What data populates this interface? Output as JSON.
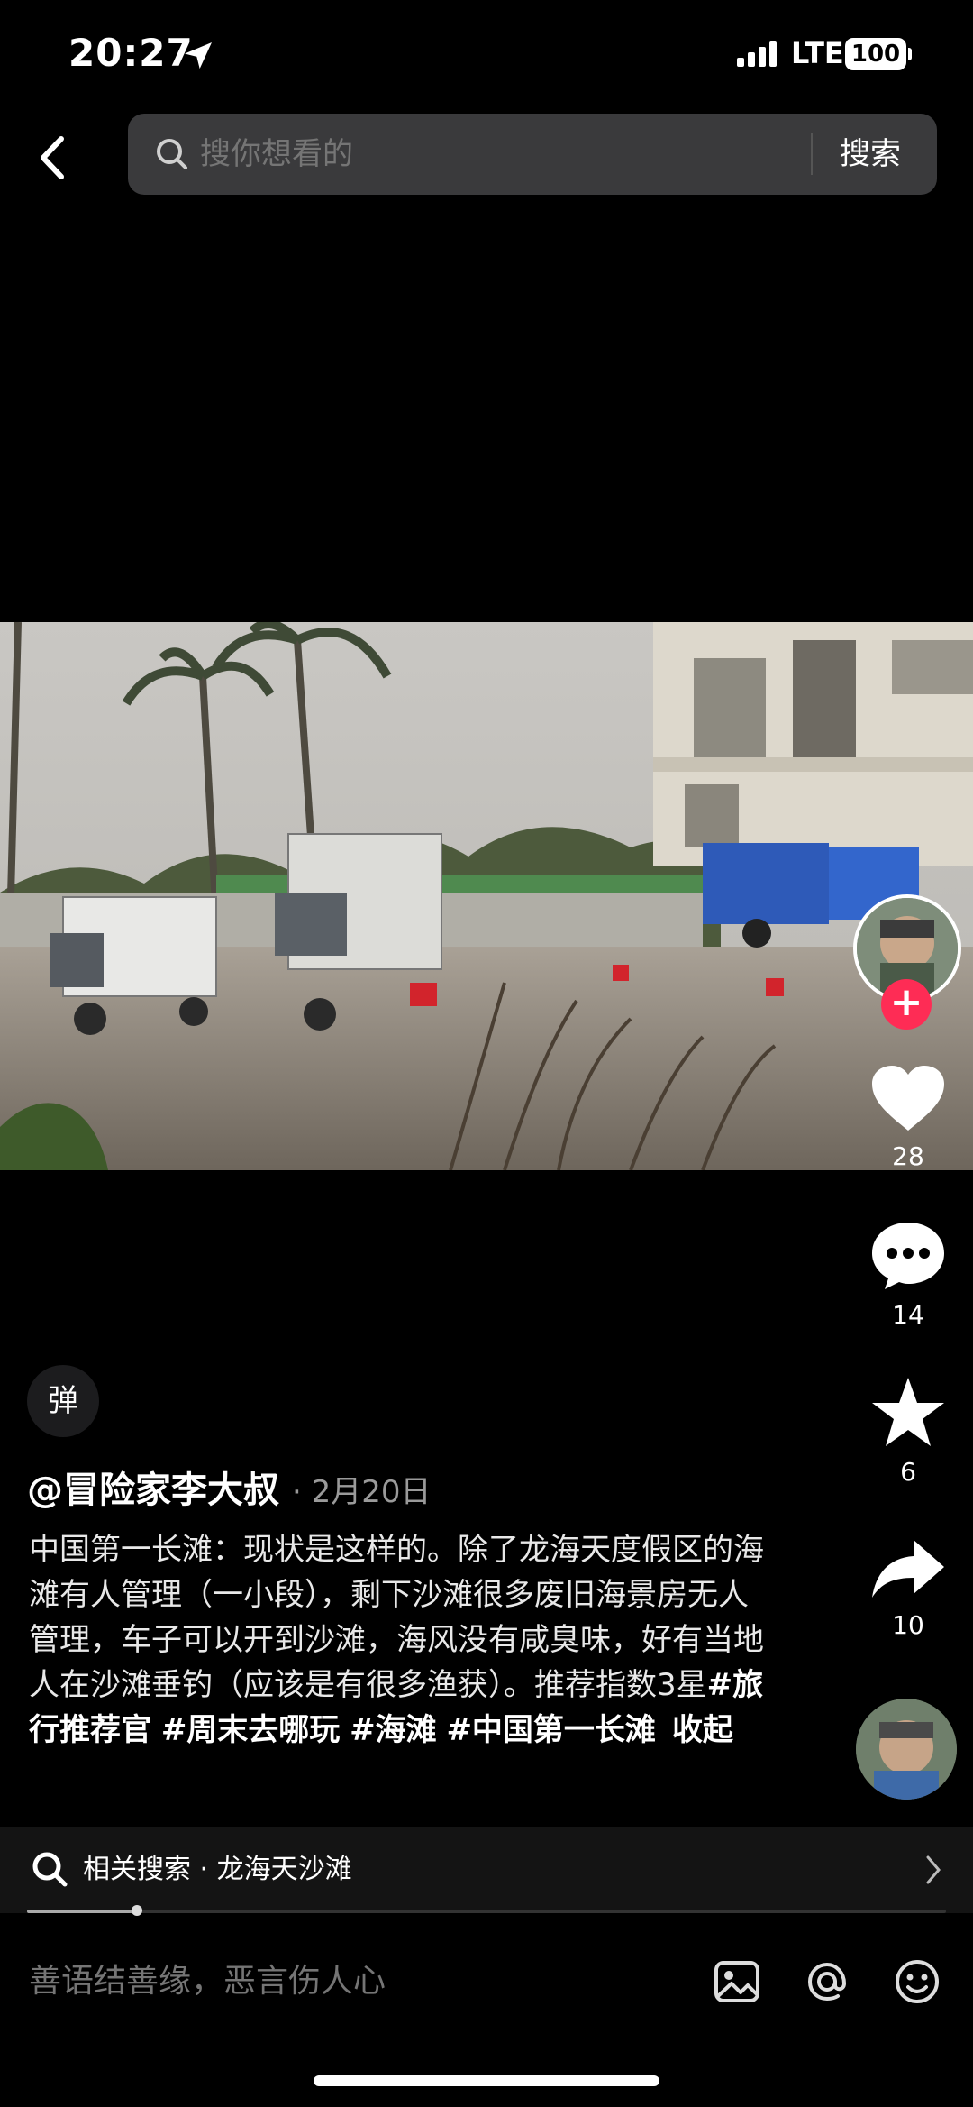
{
  "status_bar": {
    "time": "20:27",
    "network": "LTE",
    "battery": "100",
    "icons": [
      "location-arrow-icon",
      "signal-icon",
      "battery-icon"
    ]
  },
  "search": {
    "placeholder": "搜你想看的",
    "submit_label": "搜索"
  },
  "video": {
    "scene": "beach-campsite-with-vehicles"
  },
  "actions": {
    "like_count": "28",
    "comment_count": "14",
    "favorite_count": "6",
    "share_count": "10",
    "follow_symbol": "+"
  },
  "danmaku": {
    "label": "弹"
  },
  "post": {
    "author": "@冒险家李大叔",
    "date": "· 2月20日",
    "caption": "中国第一长滩：现状是这样的。除了龙海天度假区的海滩有人管理（一小段），剩下沙滩很多废旧海景房无人管理，车子可以开到沙滩，海风没有咸臭味，好有当地人在沙滩垂钓（应该是有很多渔获）。推荐指数3星",
    "hashtags": [
      "#旅行推荐官",
      "#周末去哪玩",
      "#海滩",
      "#中国第一长滩"
    ],
    "collapse_label": "收起"
  },
  "related_search": {
    "label": "相关搜索 · 龙海天沙滩"
  },
  "progress": {
    "fraction": 0.12
  },
  "comment": {
    "placeholder": "善语结善缘，恶言伤人心"
  },
  "colors": {
    "accent": "#fe2c55",
    "background": "#000000",
    "search_bg": "#3a3a3c"
  }
}
